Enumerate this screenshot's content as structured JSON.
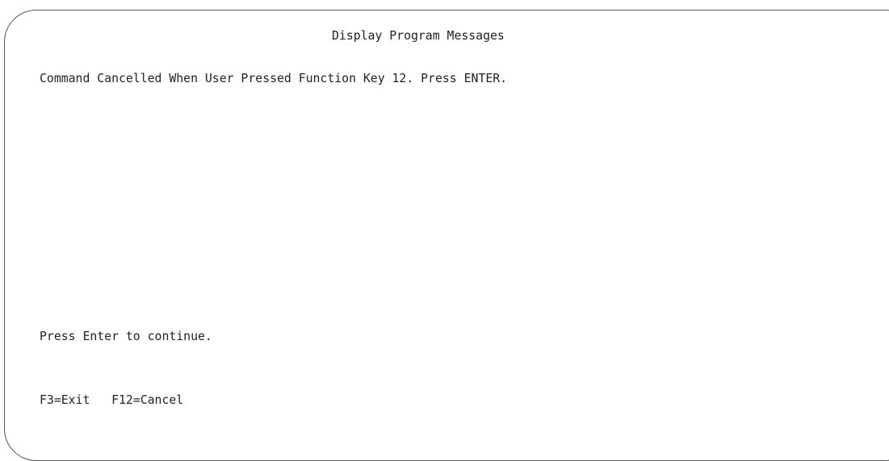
{
  "screen": {
    "title": "Display Program Messages",
    "message": "Command Cancelled When User Pressed Function Key 12. Press ENTER.",
    "prompt": "Press Enter to continue.",
    "function_keys": [
      {
        "label": "F3=Exit"
      },
      {
        "label": "F12=Cancel"
      }
    ]
  },
  "colors": {
    "background": "#ffffff",
    "text": "#222222",
    "border": "#555555"
  }
}
